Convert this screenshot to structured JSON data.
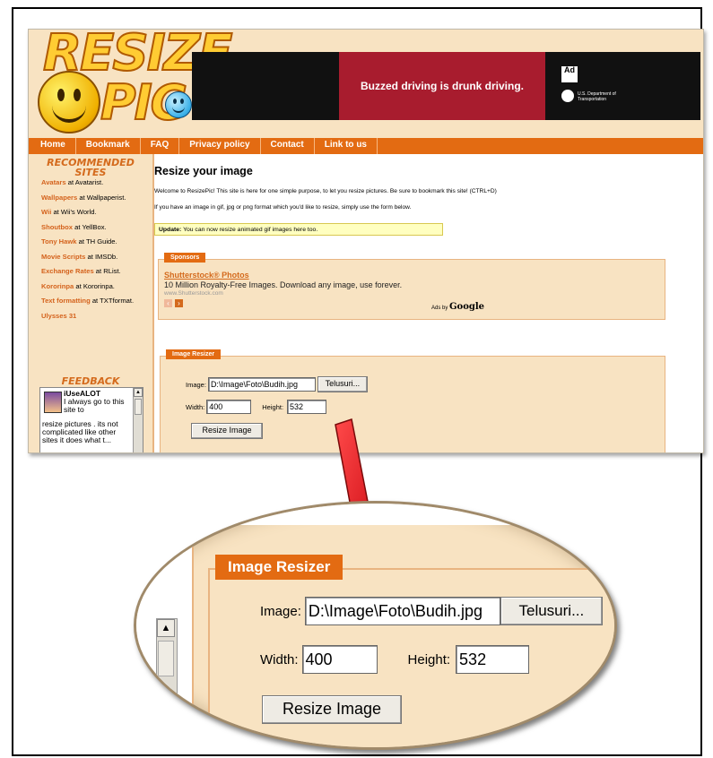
{
  "site": {
    "logo_line1": "RESIZE",
    "logo_line2": "PIC"
  },
  "ad_banner": {
    "slogan": "Buzzed driving is drunk driving.",
    "ad_council": "Ad Council",
    "sponsor": "U.S. Department of Transportation"
  },
  "nav": {
    "items": [
      "Home",
      "Bookmark",
      "FAQ",
      "Privacy policy",
      "Contact",
      "Link to us"
    ]
  },
  "sidebar": {
    "recommended_title_1": "RECOMMENDED",
    "recommended_title_2": "SITES",
    "sites": [
      {
        "name": "Avatars",
        "where": "at Avatarist."
      },
      {
        "name": "Wallpapers",
        "where": "at Wallpaperist."
      },
      {
        "name": "Wii",
        "where": "at Wii's World."
      },
      {
        "name": "Shoutbox",
        "where": "at YellBox."
      },
      {
        "name": "Tony Hawk",
        "where": "at TH Guide."
      },
      {
        "name": "Movie Scripts",
        "where": "at IMSDb."
      },
      {
        "name": "Exchange Rates",
        "where": "at RList."
      },
      {
        "name": "Kororinpa",
        "where": "at Kororinpa."
      },
      {
        "name": "Text formatting",
        "where": "at TXTformat."
      },
      {
        "name": "Ulysses 31",
        "where": ""
      }
    ],
    "feedback_title": "FEEDBACK",
    "feedback": {
      "user": "iUseALOT",
      "text_top": "I always go to this site to",
      "text_bottom": "resize pictures . its not complicated like other sites it does what t..."
    }
  },
  "main": {
    "heading": "Resize your image",
    "intro1": "Welcome to ResizePic! This site is here for one simple purpose, to let you resize pictures. Be sure to bookmark this site! (CTRL+D)",
    "intro2": "If you have an image in gif, jpg or png format which you'd like to resize, simply use the form below.",
    "update_label": "Update:",
    "update_text": "You can now resize animated gif images here too."
  },
  "sponsors": {
    "tab": "Sponsors",
    "link": "Shutterstock® Photos",
    "description": "10 Million Royalty-Free Images. Download any image, use forever.",
    "url": "www.Shutterstock.com",
    "ads_by": "Ads by",
    "google": "Google"
  },
  "resizer": {
    "tab": "Image Resizer",
    "image_label": "Image:",
    "image_value": "D:\\Image\\Foto\\Budih.jpg",
    "browse_button": "Telusuri...",
    "width_label": "Width:",
    "width_value": "400",
    "height_label": "Height:",
    "height_value": "532",
    "resize_button": "Resize Image"
  },
  "colors": {
    "accent_orange": "#e36b12",
    "panel_beige": "#f8e3c2",
    "arrow_red": "#e4141b"
  }
}
